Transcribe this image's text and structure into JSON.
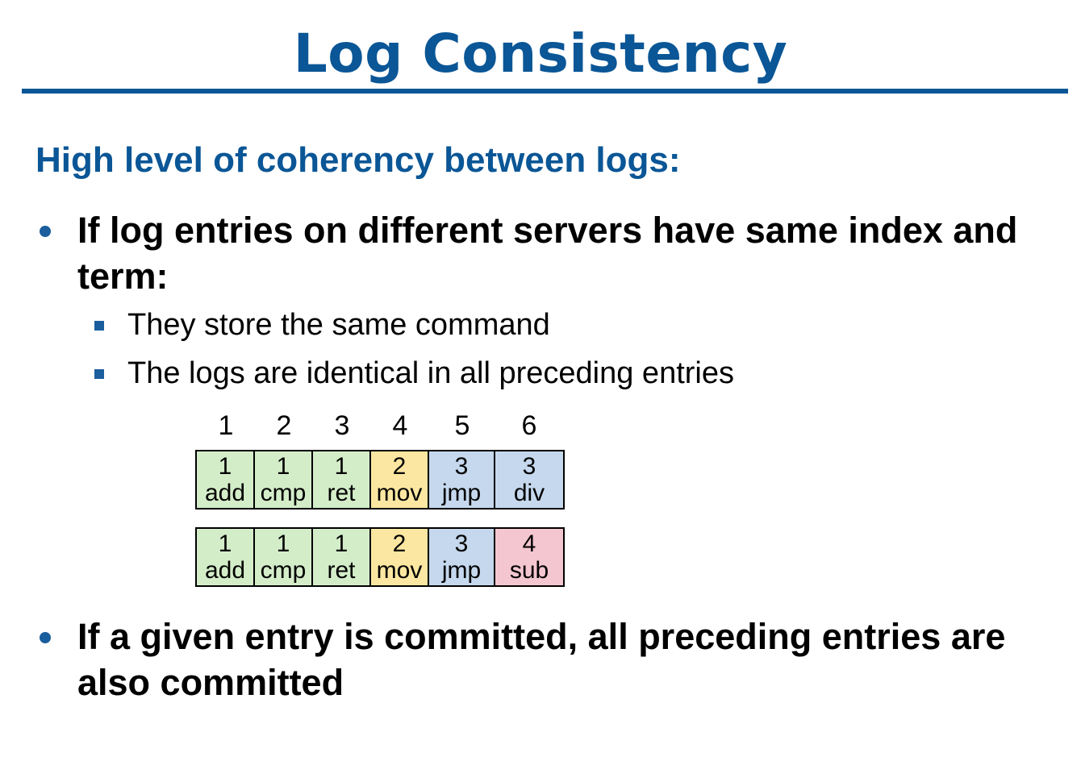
{
  "title": "Log Consistency",
  "subtitle": "High level of coherency between logs:",
  "bullets": [
    {
      "text": "If log entries on different servers have same index and term:",
      "subitems": [
        "They store the same command",
        "The logs are identical in all preceding entries"
      ]
    },
    {
      "text": "If a given entry is committed, all preceding entries are also committed"
    }
  ],
  "diagram": {
    "indices": [
      "1",
      "2",
      "3",
      "4",
      "5",
      "6"
    ],
    "logs": [
      [
        {
          "term": "1",
          "cmd": "add",
          "color": "#d4edc9"
        },
        {
          "term": "1",
          "cmd": "cmp",
          "color": "#d4edc9"
        },
        {
          "term": "1",
          "cmd": "ret",
          "color": "#d4edc9"
        },
        {
          "term": "2",
          "cmd": "mov",
          "color": "#fbe7a1"
        },
        {
          "term": "3",
          "cmd": "jmp",
          "color": "#c5d8ed"
        },
        {
          "term": "3",
          "cmd": "div",
          "color": "#c5d8ed"
        }
      ],
      [
        {
          "term": "1",
          "cmd": "add",
          "color": "#d4edc9"
        },
        {
          "term": "1",
          "cmd": "cmp",
          "color": "#d4edc9"
        },
        {
          "term": "1",
          "cmd": "ret",
          "color": "#d4edc9"
        },
        {
          "term": "2",
          "cmd": "mov",
          "color": "#fbe7a1"
        },
        {
          "term": "3",
          "cmd": "jmp",
          "color": "#c5d8ed"
        },
        {
          "term": "4",
          "cmd": "sub",
          "color": "#f4c6d0"
        }
      ]
    ]
  }
}
